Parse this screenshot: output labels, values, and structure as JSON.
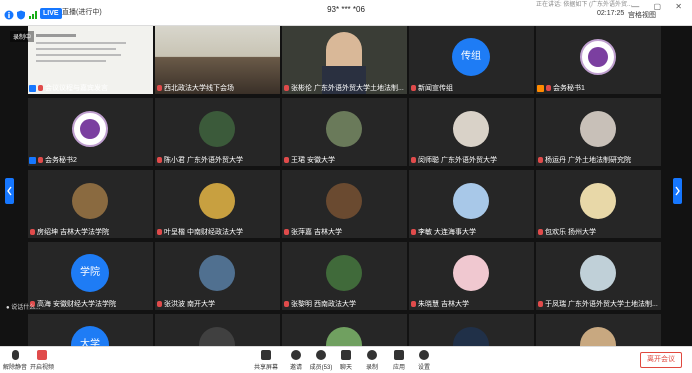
{
  "title_bar": {
    "live_label": "LIVE",
    "live_status": "直播(进行中)",
    "meeting_title": "93* *** *06",
    "tip_text": "正在讲话: 依据如下 (广东外语外贸...",
    "clock": "02:17:25",
    "view_mode": "宫格视图"
  },
  "recording_label": "录制中",
  "chat_preview": "说话什么...",
  "participants": [
    {
      "name": "会议议程与嘉宾发言",
      "kind": "video-slide"
    },
    {
      "name": "西北政法大学线下会场",
      "kind": "video-room"
    },
    {
      "name": "张彬伦 广东外语外贸大学土地法制...",
      "kind": "video-person"
    },
    {
      "name": "新闻宣传组",
      "kind": "text-avatar",
      "avatar_text": "传组"
    },
    {
      "name": "会务秘书1",
      "kind": "badge"
    },
    {
      "name": "会务秘书2",
      "kind": "badge"
    },
    {
      "name": "陈小君 广东外语外贸大学",
      "kind": "photo",
      "color": "#3b5a3a"
    },
    {
      "name": "王珺 安徽大学",
      "kind": "photo",
      "color": "#6a7a5a"
    },
    {
      "name": "闵师聪 广东外语外贸大学",
      "kind": "photo",
      "color": "#d9d2c8"
    },
    {
      "name": "杨运丹 广外土地法制研究院",
      "kind": "photo",
      "color": "#c8c0b8"
    },
    {
      "name": "房绍坤 吉林大学法学院",
      "kind": "photo",
      "color": "#8a6a40"
    },
    {
      "name": "叶呈楷 中南财经政法大学",
      "kind": "photo",
      "color": "#c8a040"
    },
    {
      "name": "张萍嘉 吉林大学",
      "kind": "photo",
      "color": "#6a4a30"
    },
    {
      "name": "李敏 大连海事大学",
      "kind": "photo",
      "color": "#a8c8e8"
    },
    {
      "name": "包欢乐 扬州大学",
      "kind": "photo",
      "color": "#e8d8a8"
    },
    {
      "name": "高海 安徽财经大学法学院",
      "kind": "text-avatar",
      "avatar_text": "学院"
    },
    {
      "name": "张洪波 南开大学",
      "kind": "photo",
      "color": "#507090"
    },
    {
      "name": "张黎明 西南政法大学",
      "kind": "photo",
      "color": "#406a3a"
    },
    {
      "name": "朱晓慧 吉林大学",
      "kind": "photo",
      "color": "#f0c8d0"
    },
    {
      "name": "于凤瑞 广东外语外贸大学土地法制...",
      "kind": "photo",
      "color": "#c0d0d8"
    },
    {
      "name": "",
      "kind": "text-avatar",
      "avatar_text": "大学"
    },
    {
      "name": "",
      "kind": "photo",
      "color": "#404040"
    },
    {
      "name": "",
      "kind": "photo",
      "color": "#70a060"
    },
    {
      "name": "",
      "kind": "photo",
      "color": "#203048"
    },
    {
      "name": "",
      "kind": "photo",
      "color": "#c8a880"
    }
  ],
  "toolbar": {
    "mute_label": "解除静音",
    "video_label": "开启视频",
    "share_label": "共享屏幕",
    "invite_label": "邀请",
    "members_label": "成员(53)",
    "chat_label": "聊天",
    "record_label": "录制",
    "apps_label": "应用",
    "settings_label": "设置",
    "leave_label": "离开会议"
  },
  "colors": {
    "accent": "#1677ff",
    "mic_muted": "#e04b4b",
    "leave": "#e0483e"
  }
}
